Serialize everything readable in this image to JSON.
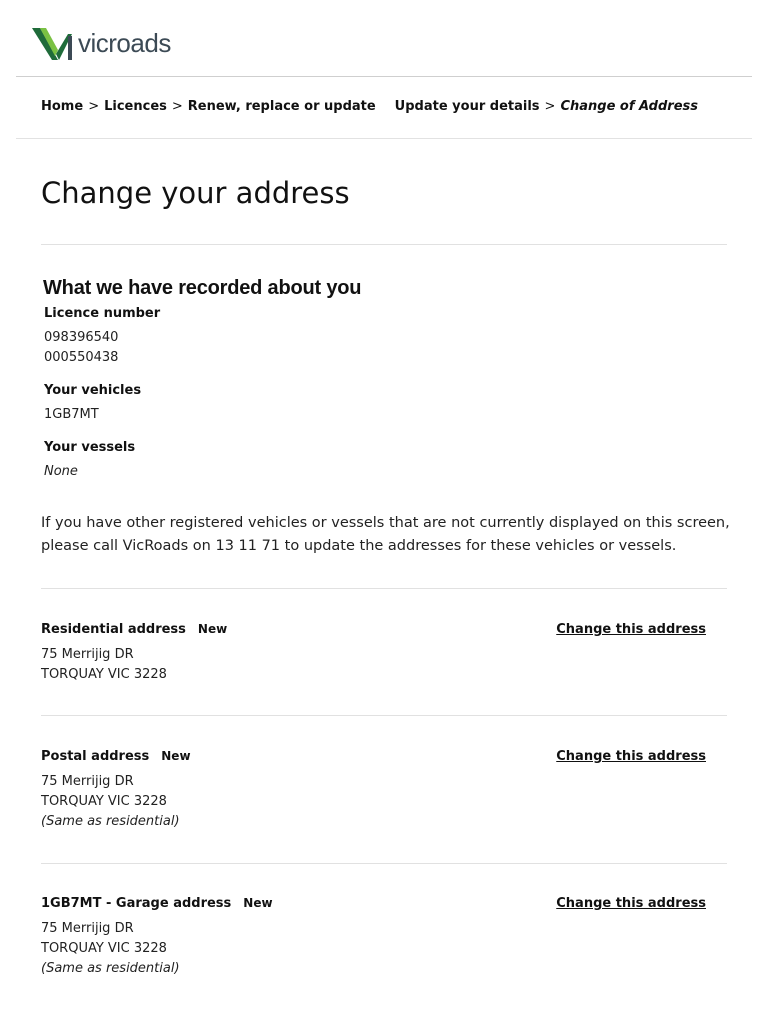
{
  "brand": {
    "logo_text": "vicroads",
    "colors": {
      "logo_green_dark": "#1f6b3a",
      "logo_green_light": "#7ac143",
      "logo_text": "#3c4a55"
    }
  },
  "breadcrumb": {
    "items": [
      "Home",
      "Licences",
      "Renew, replace or update",
      "Update your details",
      "Change of Address"
    ],
    "separator": ">"
  },
  "page": {
    "title": "Change your address"
  },
  "recorded": {
    "heading": "What we have recorded about you",
    "licence_label": "Licence number",
    "licence_values": [
      "098396540",
      "000550438"
    ],
    "vehicles_label": "Your vehicles",
    "vehicles_values": [
      "1GB7MT"
    ],
    "vessels_label": "Your vessels",
    "vessels_value": "None"
  },
  "info": {
    "text": "If you have other registered vehicles or vessels that are not currently displayed on this screen, please call VicRoads on 13 11 71 to update the addresses for these vehicles or vessels."
  },
  "addresses": [
    {
      "title": "Residential address",
      "badge": "New",
      "lines": [
        "75 Merrijig DR",
        "TORQUAY VIC 3228"
      ],
      "note": "",
      "action": "Change this address"
    },
    {
      "title": "Postal address",
      "badge": "New",
      "lines": [
        "75 Merrijig DR",
        "TORQUAY VIC 3228"
      ],
      "note": "(Same as residential)",
      "action": "Change this address"
    },
    {
      "title": "1GB7MT - Garage address",
      "badge": "New",
      "lines": [
        "75 Merrijig DR",
        "TORQUAY VIC 3228"
      ],
      "note": "(Same as residential)",
      "action": "Change this address"
    }
  ]
}
